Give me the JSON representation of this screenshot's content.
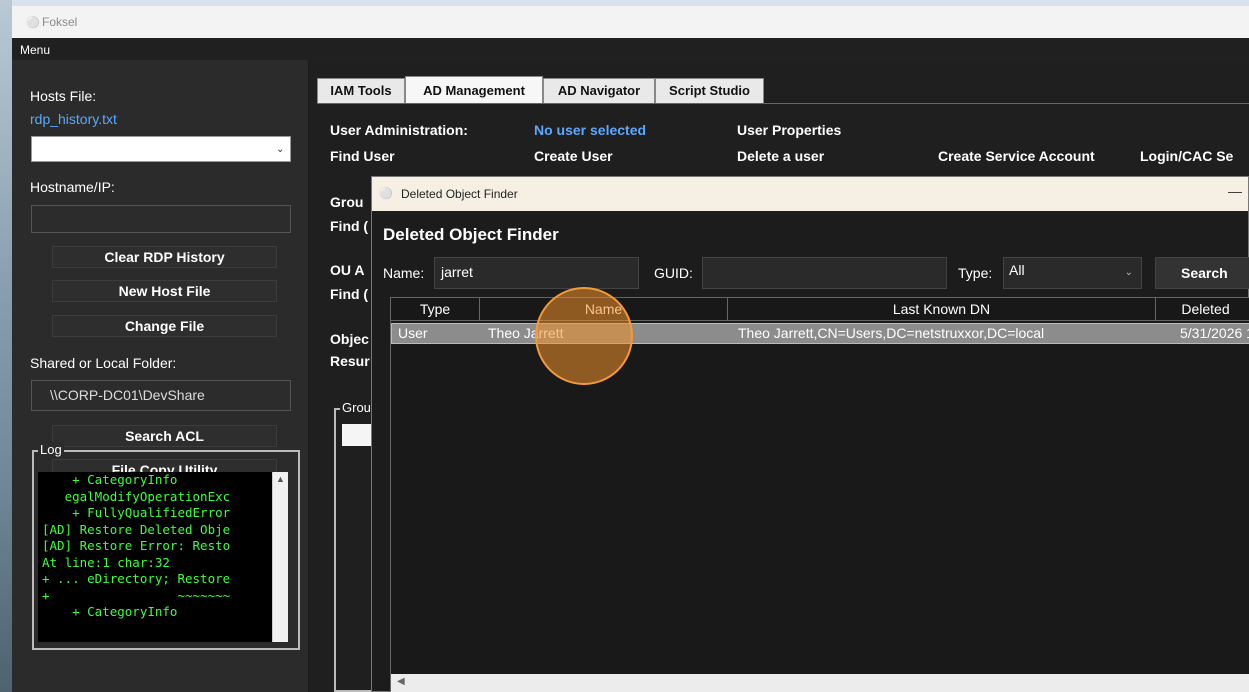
{
  "window": {
    "title": "Foksel",
    "menu": "Menu"
  },
  "left_panel": {
    "hosts_file_label": "Hosts File:",
    "hosts_file_link": "rdp_history.txt",
    "hostname_label": "Hostname/IP:",
    "buttons": {
      "clear_rdp": "Clear RDP History",
      "new_host_file": "New Host File",
      "change_file": "Change File",
      "search_acl": "Search ACL",
      "file_copy": "File Copy Utility"
    },
    "shared_folder_label": "Shared or Local Folder:",
    "shared_folder_value": "\\\\CORP-DC01\\DevShare",
    "log_label": "Log",
    "log_lines": [
      "    + CategoryInfo",
      "   egalModifyOperationExc",
      "    + FullyQualifiedError",
      "[AD] Restore Deleted Obje",
      "[AD] Restore Error: Resto",
      "At line:1 char:32",
      "+ ... eDirectory; Restore",
      "+                 ~~~~~~~",
      "    + CategoryInfo"
    ]
  },
  "tabs": [
    "IAM Tools",
    "AD Management",
    "AD Navigator",
    "Script Studio"
  ],
  "ad_panel": {
    "user_admin_label": "User Administration:",
    "no_user": "No user selected",
    "user_properties": "User Properties",
    "find_user": "Find User",
    "create_user": "Create User",
    "delete_user": "Delete a user",
    "create_service_account": "Create Service Account",
    "login_cac": "Login/CAC Se",
    "group_label": "Grou",
    "find_g": "Find (",
    "ou_label": "OU A",
    "find_o": "Find (",
    "obj_label": "Objec",
    "resume_label": "Resur",
    "group_frame_label": "Grou"
  },
  "dialog": {
    "title": "Deleted Object Finder",
    "heading": "Deleted Object Finder",
    "minimize": "—",
    "name_label": "Name:",
    "name_value": "jarret",
    "guid_label": "GUID:",
    "guid_value": "",
    "type_label": "Type:",
    "type_value": "All",
    "search_button": "Search",
    "columns": [
      "Type",
      "Name",
      "Last Known DN",
      "Deleted"
    ],
    "rows": [
      {
        "type": "User",
        "name": "Theo Jarrett",
        "dn": "Theo Jarrett,CN=Users,DC=netstruxxor,DC=local",
        "deleted": "5/31/2026 1"
      }
    ]
  }
}
